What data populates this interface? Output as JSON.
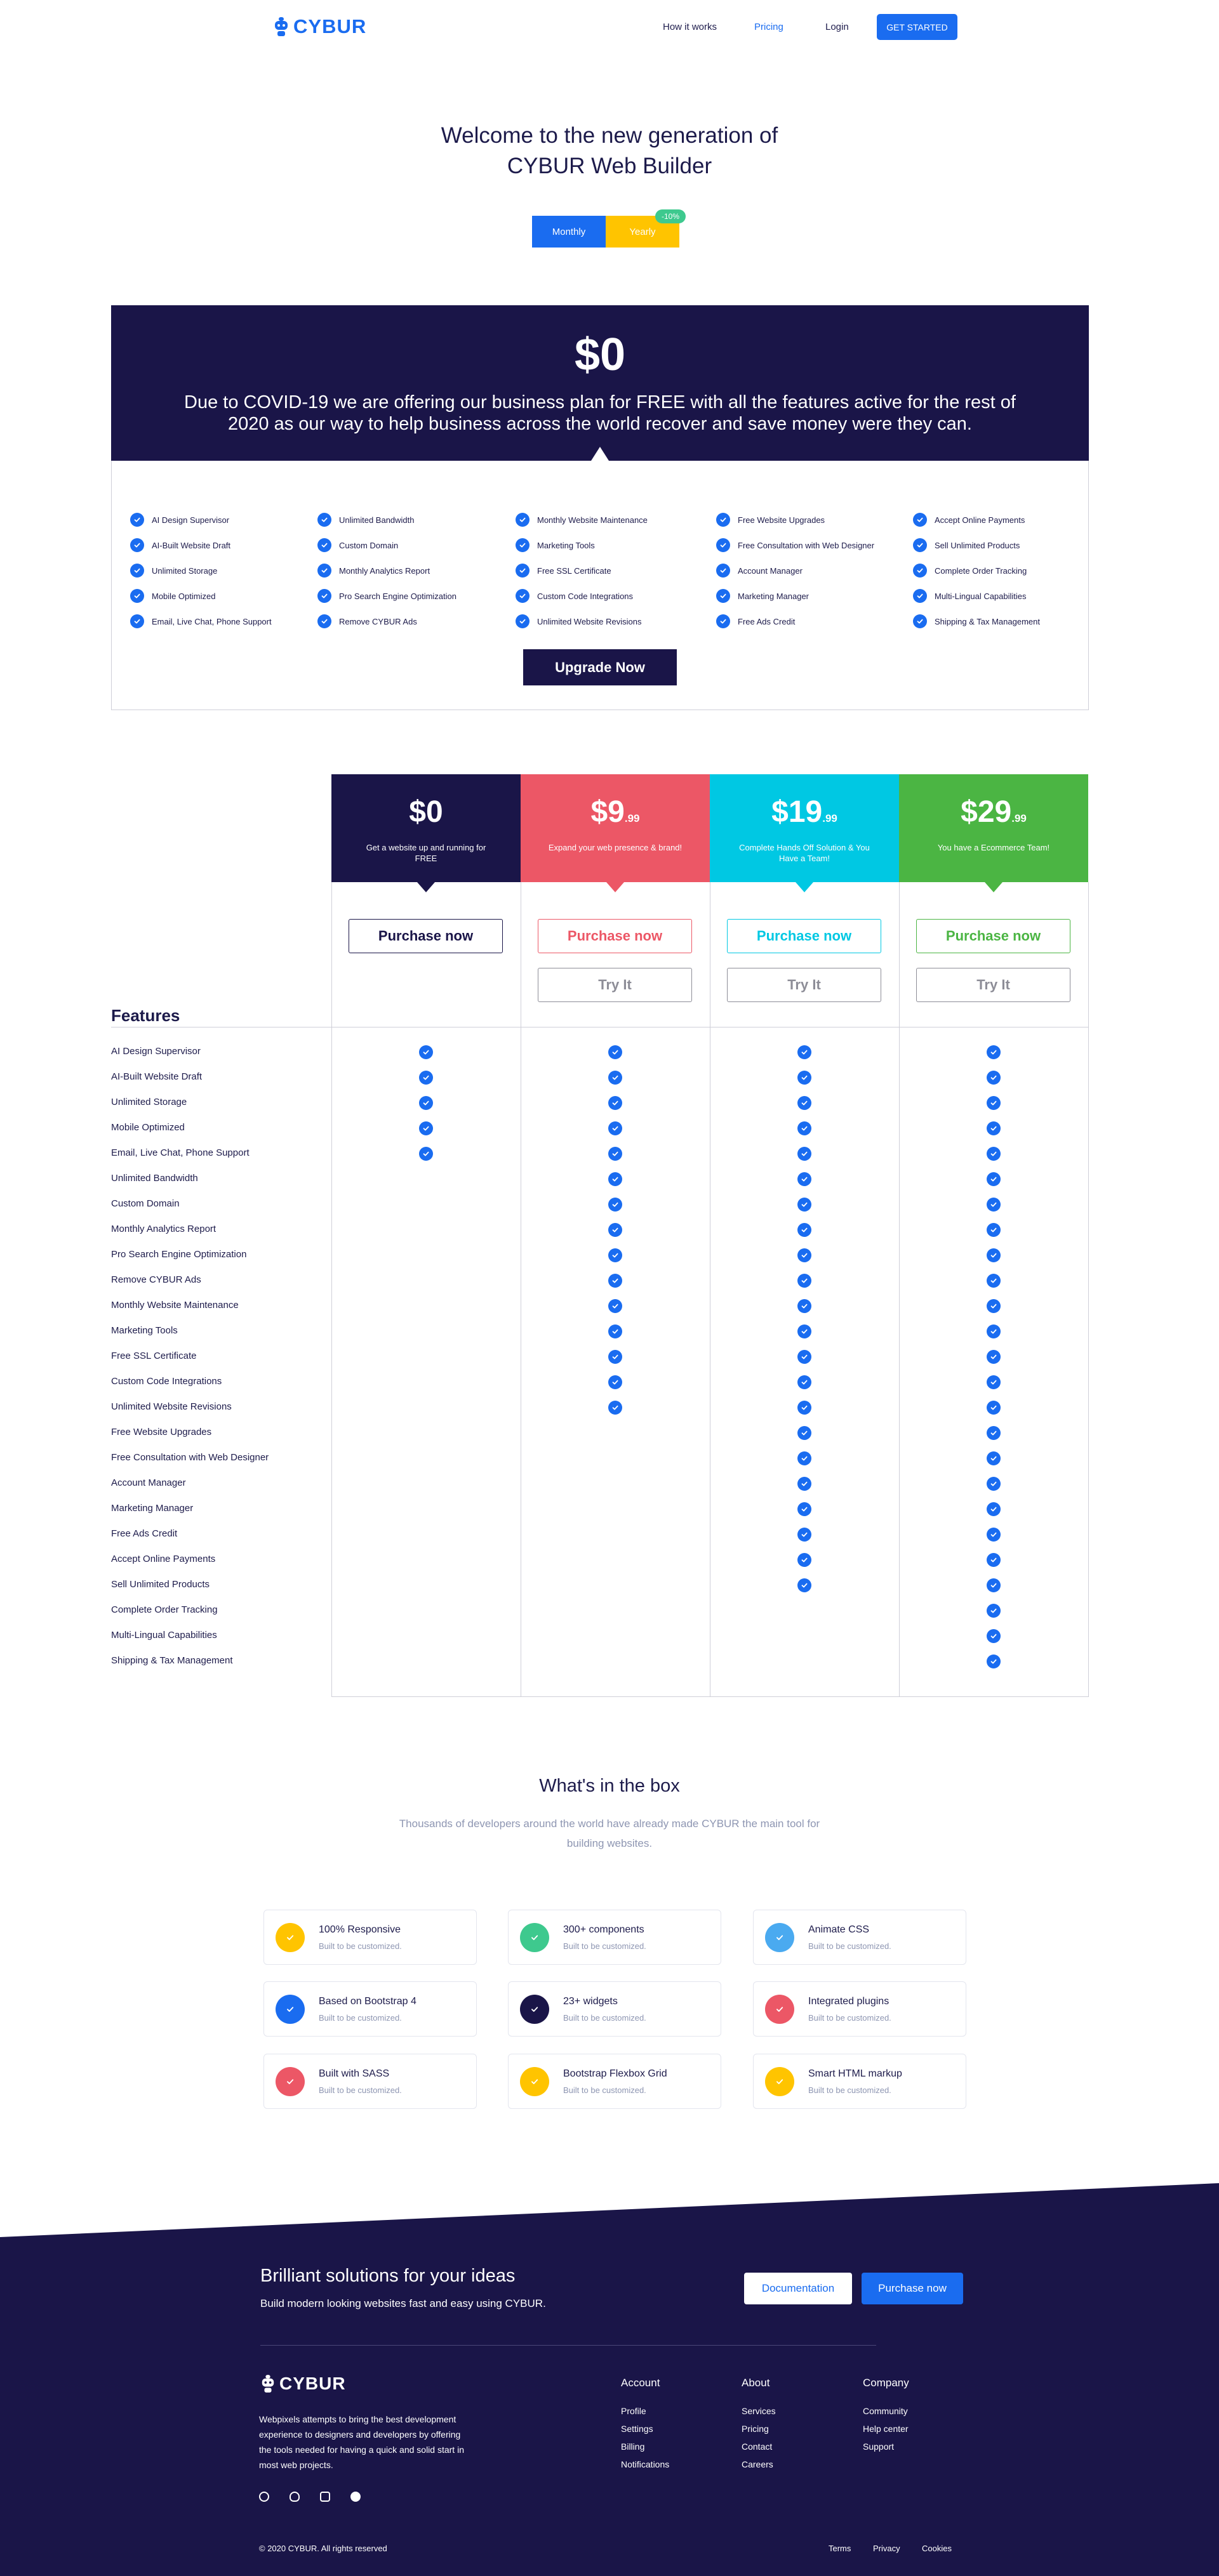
{
  "nav": {
    "logo_text": "CYBUR",
    "links": [
      "How it works",
      "Pricing",
      "Login"
    ],
    "cta": "GET STARTED"
  },
  "hero": {
    "title_line1": "Welcome to the new generation of",
    "title_line2": "CYBUR Web Builder",
    "toggle_monthly": "Monthly",
    "toggle_yearly": "Yearly",
    "discount_badge": "-10%"
  },
  "promo": {
    "price": "$0",
    "text": "Due to COVID-19 we are offering our business plan for FREE with all the features active for the rest of 2020 as our way to help business across the world recover and save money were they can.",
    "columns": [
      [
        "AI Design Supervisor",
        "AI-Built Website Draft",
        "Unlimited Storage",
        "Mobile Optimized",
        "Email, Live Chat, Phone Support"
      ],
      [
        "Unlimited Bandwidth",
        "Custom Domain",
        "Monthly Analytics Report",
        "Pro Search Engine Optimization",
        "Remove CYBUR Ads"
      ],
      [
        "Monthly Website Maintenance",
        "Marketing Tools",
        "Free SSL Certificate",
        "Custom Code Integrations",
        "Unlimited Website Revisions"
      ],
      [
        "Free Website Upgrades",
        "Free Consultation with Web Designer",
        "Account Manager",
        "Marketing Manager",
        "Free Ads Credit"
      ],
      [
        "Accept Online Payments",
        "Sell Unlimited Products",
        "Complete Order Tracking",
        "Multi-Lingual Capabilities",
        "Shipping & Tax Management"
      ]
    ],
    "upgrade_label": "Upgrade Now"
  },
  "plans": [
    {
      "price": "$0",
      "cents": "",
      "desc": "Get a website up and running for FREE",
      "color": "#1a1548",
      "purchase": "Purchase now",
      "try": "",
      "features_included": 5
    },
    {
      "price": "$9",
      "cents": ".99",
      "desc": "Expand your web presence & brand!",
      "color": "#ec5766",
      "purchase": "Purchase now",
      "try": "Try It",
      "features_included": 15
    },
    {
      "price": "$19",
      "cents": ".99",
      "desc": "Complete Hands Off Solution & You Have a Team!",
      "color": "#00c8e3",
      "purchase": "Purchase now",
      "try": "Try It",
      "features_included": 22
    },
    {
      "price": "$29",
      "cents": ".99",
      "desc": "You have a Ecommerce Team!",
      "color": "#4bb543",
      "purchase": "Purchase now",
      "try": "Try It",
      "features_included": 25
    }
  ],
  "features_heading": "Features",
  "features": [
    "AI Design Supervisor",
    "AI-Built Website Draft",
    "Unlimited Storage",
    "Mobile Optimized",
    "Email, Live Chat, Phone Support",
    "Unlimited Bandwidth",
    "Custom Domain",
    "Monthly Analytics Report",
    "Pro Search Engine Optimization",
    "Remove CYBUR Ads",
    "Monthly Website Maintenance",
    "Marketing Tools",
    "Free SSL Certificate",
    "Custom Code Integrations",
    "Unlimited Website Revisions",
    "Free Website Upgrades",
    "Free Consultation with Web Designer",
    "Account Manager",
    "Marketing Manager",
    "Free Ads Credit",
    "Accept Online Payments",
    "Sell Unlimited Products",
    "Complete Order Tracking",
    "Multi-Lingual Capabilities",
    "Shipping & Tax Management"
  ],
  "box": {
    "title": "What's in the box",
    "subtitle": "Thousands of developers around the world have already made CYBUR the main tool for building websites.",
    "cards": [
      {
        "title": "100% Responsive",
        "sub": "Built to be customized.",
        "color": "#ffc400",
        "icon": "check-icon"
      },
      {
        "title": "300+ components",
        "sub": "Built to be customized.",
        "color": "#3ec98e",
        "icon": "check-icon"
      },
      {
        "title": "Animate CSS",
        "sub": "Built to be customized.",
        "color": "#4aaaf0",
        "icon": "check-icon"
      },
      {
        "title": "Based on Bootstrap 4",
        "sub": "Built to be customized.",
        "color": "#1a6cf0",
        "icon": "check-icon"
      },
      {
        "title": "23+ widgets",
        "sub": "Built to be customized.",
        "color": "#1a1548",
        "icon": "check-icon"
      },
      {
        "title": "Integrated plugins",
        "sub": "Built to be customized.",
        "color": "#ec5766",
        "icon": "check-icon"
      },
      {
        "title": "Built with SASS",
        "sub": "Built to be customized.",
        "color": "#ec5766",
        "icon": "check-icon"
      },
      {
        "title": "Bootstrap Flexbox Grid",
        "sub": "Built to be customized.",
        "color": "#ffc400",
        "icon": "check-icon"
      },
      {
        "title": "Smart HTML markup",
        "sub": "Built to be customized.",
        "color": "#ffc400",
        "icon": "check-icon"
      }
    ]
  },
  "footer": {
    "cta_title": "Brilliant solutions for your ideas",
    "cta_sub": "Build modern looking websites fast and easy using CYBUR.",
    "doc_label": "Documentation",
    "buy_label": "Purchase now",
    "logo_text": "CYBUR",
    "desc": "Webpixels attempts to bring the best development experience to designers and developers by offering the tools needed for having a quick and solid start in most web projects.",
    "columns": [
      {
        "title": "Account",
        "links": [
          "Profile",
          "Settings",
          "Billing",
          "Notifications"
        ]
      },
      {
        "title": "About",
        "links": [
          "Services",
          "Pricing",
          "Contact",
          "Careers"
        ]
      },
      {
        "title": "Company",
        "links": [
          "Community",
          "Help center",
          "Support"
        ]
      }
    ],
    "socials": [
      "dribbble-icon",
      "github-icon",
      "instagram-icon",
      "facebook-icon"
    ],
    "copyright": "© 2020 CYBUR. All rights reserved",
    "legal": [
      "Terms",
      "Privacy",
      "Cookies"
    ]
  },
  "colors": {
    "primary": "#1a6cf0",
    "navy": "#1a1548",
    "yellow": "#ffc400"
  }
}
